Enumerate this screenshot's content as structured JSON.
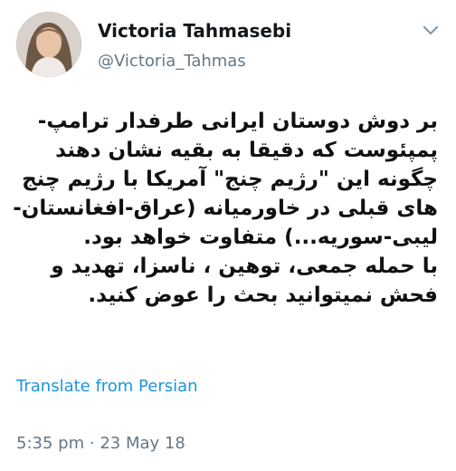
{
  "tweet": {
    "author_name": "Victoria Tahmasebi",
    "author_handle": "@Victoria_Tahmas",
    "lines": [
      "بر دوش دوستان ایرانی طرفدار ترامپ-",
      "پمپئوست که دقیقا به بقیه نشان دهند",
      "چگونه این \"رژیم چنج\" آمریکا با رژیم چنج",
      "های قبلی در خاورمیانه (عراق-افغانستان-",
      "لیبی-سوریه...) متفاوت خواهد بود.",
      "با حمله جمعی، توهین ، ناسزا، تهدید و",
      "فحش  نمیتوانید بحث را عوض کنید."
    ],
    "translate_label": "Translate from Persian",
    "time": "5:35 pm",
    "separator": "·",
    "date": "23 May 18"
  },
  "icons": {
    "menu": "chevron-down-icon"
  },
  "colors": {
    "link": "#1b95e0",
    "muted": "#657786",
    "text": "#14171a"
  }
}
